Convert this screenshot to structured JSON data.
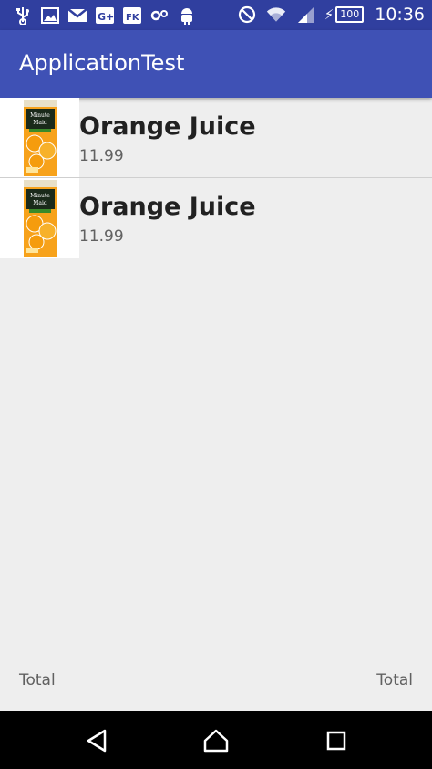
{
  "status_bar": {
    "time": "10:36",
    "battery_level": "100",
    "left_icons": [
      "usb-icon",
      "image-icon",
      "gmail-icon",
      "google-plus-icon",
      "fk-icon",
      "settings-sync-icon",
      "android-icon"
    ],
    "right_icons": [
      "do-not-disturb-icon",
      "wifi-icon",
      "cell-signal-icon",
      "battery-charging-icon"
    ]
  },
  "app_bar": {
    "title": "ApplicationTest",
    "color": "#3f51b5",
    "status_color": "#303f9f"
  },
  "list": {
    "items": [
      {
        "name": "Orange Juice",
        "price": "11.99",
        "image": "orange-juice-carton"
      },
      {
        "name": "Orange Juice",
        "price": "11.99",
        "image": "orange-juice-carton"
      }
    ]
  },
  "totals": {
    "left_label": "Total",
    "right_label": "Total"
  },
  "nav_bar": {
    "buttons": [
      "back-icon",
      "home-icon",
      "recents-icon"
    ]
  }
}
